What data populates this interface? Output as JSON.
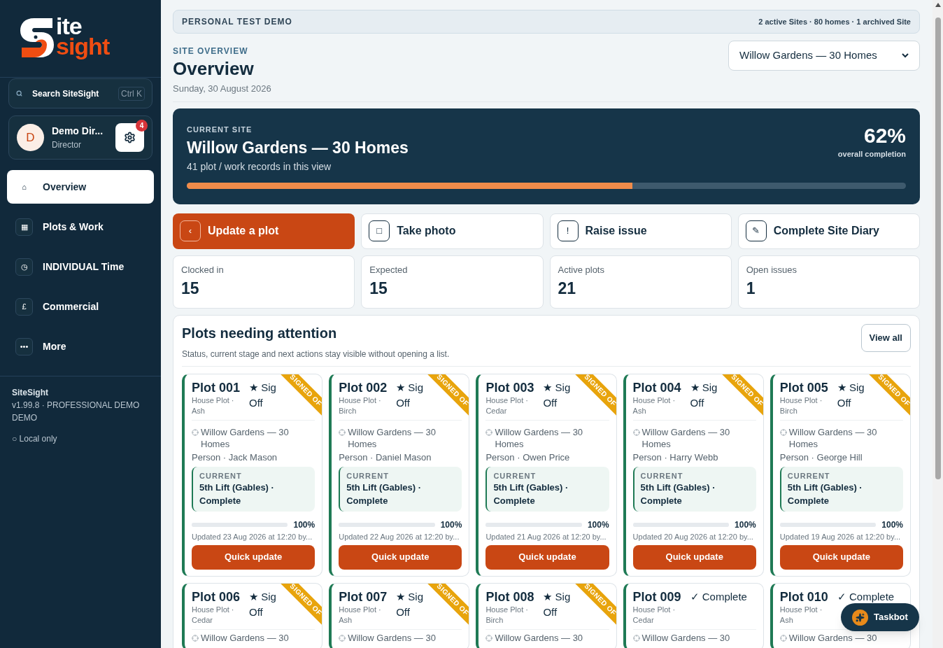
{
  "sidebar": {
    "logo": {
      "top": "ite",
      "bottom": "sight"
    },
    "search": {
      "placeholder": "Search SiteSight",
      "shortcut": "Ctrl K"
    },
    "user": {
      "initial": "D",
      "name": "Demo Dir...",
      "role": "Director",
      "notifications": "4"
    },
    "nav": [
      {
        "icon": "⌂",
        "label": "Overview",
        "selected": true
      },
      {
        "icon": "▦",
        "label": "Plots & Work",
        "selected": false
      },
      {
        "icon": "◷",
        "label": "INDIVIDUAL Time",
        "selected": false
      },
      {
        "icon": "£",
        "label": "Commercial",
        "selected": false
      },
      {
        "icon": "•••",
        "label": "More",
        "selected": false
      }
    ],
    "footer": {
      "app": "SiteSight",
      "version": "v1.99.8 · PROFESSIONAL DEMO DEMO",
      "status": "○ Local only"
    }
  },
  "banner": {
    "title": "PERSONAL TEST DEMO",
    "summary": "2 active Sites · 80 homes · 1 archived Site"
  },
  "header": {
    "eyebrow": "SITE OVERVIEW",
    "title": "Overview",
    "date": "Sunday, 30 August 2026",
    "site_select": "Willow Gardens — 30 Homes"
  },
  "hero": {
    "eyebrow": "CURRENT SITE",
    "title": "Willow Gardens — 30 Homes",
    "subtitle": "41 plot / work records in this view",
    "percent": "62%",
    "caption": "overall completion",
    "level": 0.62
  },
  "actions": [
    {
      "icon": "‹",
      "label": "Update a plot",
      "kind": "primary"
    },
    {
      "icon": "□",
      "label": "Take photo",
      "kind": "secondary"
    },
    {
      "icon": "!",
      "label": "Raise issue",
      "kind": "secondary"
    },
    {
      "icon": "✎",
      "label": "Complete Site Diary",
      "kind": "secondary"
    }
  ],
  "stats": [
    {
      "label": "Clocked in",
      "value": "15"
    },
    {
      "label": "Expected",
      "value": "15"
    },
    {
      "label": "Active plots",
      "value": "21"
    },
    {
      "label": "Open issues",
      "value": "1"
    }
  ],
  "attention": {
    "title": "Plots needing attention",
    "subtitle": "Status, current stage and next actions stay visible without opening a list.",
    "view_all": "View all",
    "plots": [
      {
        "name": "Plot 001",
        "type": "House Plot · Ash",
        "status": "★ Sig Off",
        "ribbon": "SIGNED OF",
        "location": "Willow Gardens — 30 Homes",
        "person": "Person · Jack Mason",
        "current_label": "CURRENT",
        "current": "5th Lift (Gables) · Complete",
        "level": 1,
        "percent": "100%",
        "updated": "Updated 23 Aug 2026 at 12:20 by...",
        "button": "Quick update"
      },
      {
        "name": "Plot 002",
        "type": "House Plot · Birch",
        "status": "★ Sig Off",
        "ribbon": "SIGNED OF",
        "location": "Willow Gardens — 30 Homes",
        "person": "Person · Daniel Mason",
        "current_label": "CURRENT",
        "current": "5th Lift (Gables) · Complete",
        "level": 1,
        "percent": "100%",
        "updated": "Updated 22 Aug 2026 at 12:20 by...",
        "button": "Quick update"
      },
      {
        "name": "Plot 003",
        "type": "House Plot · Cedar",
        "status": "★ Sig Off",
        "ribbon": "SIGNED OF",
        "location": "Willow Gardens — 30 Homes",
        "person": "Person · Owen Price",
        "current_label": "CURRENT",
        "current": "5th Lift (Gables) · Complete",
        "level": 1,
        "percent": "100%",
        "updated": "Updated 21 Aug 2026 at 12:20 by...",
        "button": "Quick update"
      },
      {
        "name": "Plot 004",
        "type": "House Plot · Ash",
        "status": "★ Sig Off",
        "ribbon": "SIGNED OF",
        "location": "Willow Gardens — 30 Homes",
        "person": "Person · Harry Webb",
        "current_label": "CURRENT",
        "current": "5th Lift (Gables) · Complete",
        "level": 1,
        "percent": "100%",
        "updated": "Updated 20 Aug 2026 at 12:20 by...",
        "button": "Quick update"
      },
      {
        "name": "Plot 005",
        "type": "House Plot · Birch",
        "status": "★ Sig Off",
        "ribbon": "SIGNED OF",
        "location": "Willow Gardens — 30 Homes",
        "person": "Person · George Hill",
        "current_label": "CURRENT",
        "current": "5th Lift (Gables) · Complete",
        "level": 1,
        "percent": "100%",
        "updated": "Updated 19 Aug 2026 at 12:20 by...",
        "button": "Quick update"
      },
      {
        "name": "Plot 006",
        "type": "House Plot · Cedar",
        "status": "★ Sig Off",
        "ribbon": "SIGNED OF",
        "location": "Willow Gardens — 30"
      },
      {
        "name": "Plot 007",
        "type": "House Plot · Ash",
        "status": "★ Sig Off",
        "ribbon": "SIGNED OF",
        "location": "Willow Gardens — 30"
      },
      {
        "name": "Plot 008",
        "type": "House Plot · Birch",
        "status": "★ Sig Off",
        "ribbon": "SIGNED OF",
        "location": "Willow Gardens — 30"
      },
      {
        "name": "Plot 009",
        "type": "House Plot · Cedar",
        "status": "✓ Complete",
        "location": "Willow Gardens — 30"
      },
      {
        "name": "Plot 010",
        "type": "House Plot · Ash",
        "status": "✓ Complete",
        "location": "Willow Gardens — 30"
      }
    ]
  },
  "taskbot": {
    "label": "Taskbot"
  }
}
